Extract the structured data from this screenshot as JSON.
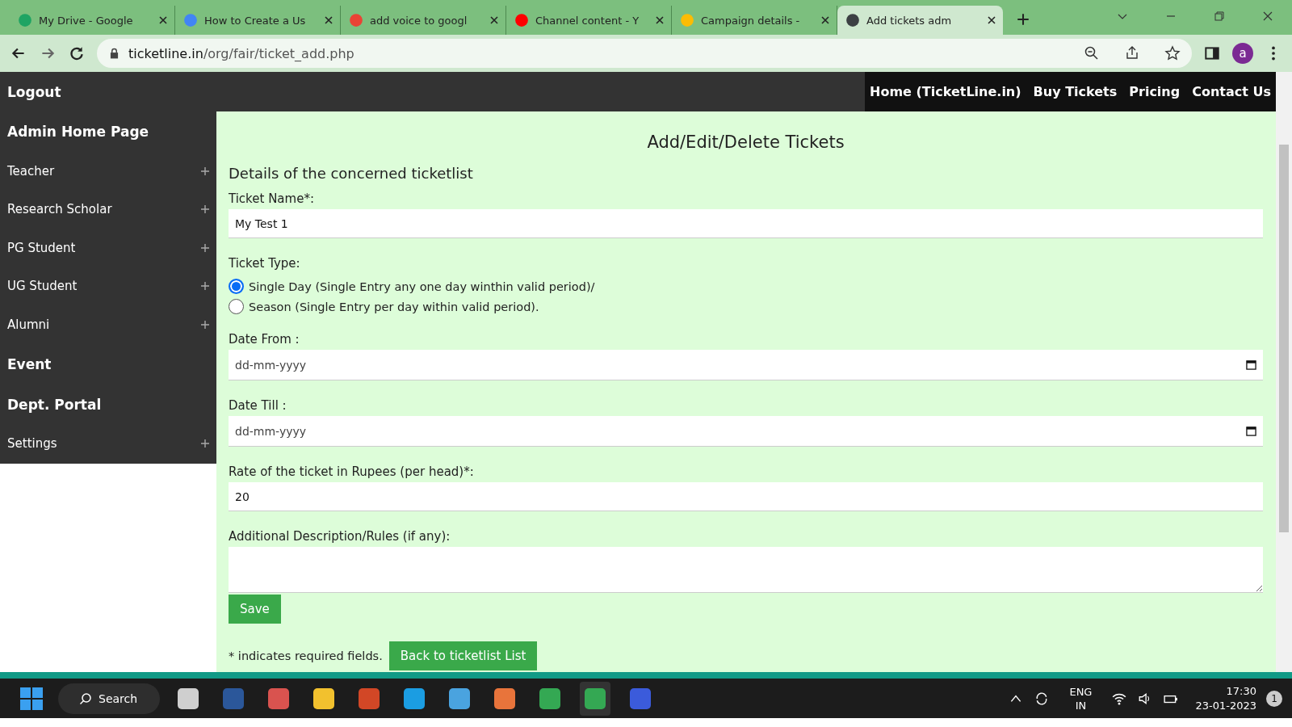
{
  "browser": {
    "tabs": [
      {
        "title": "My Drive - Google",
        "selected": false
      },
      {
        "title": "How to Create a Us",
        "selected": false
      },
      {
        "title": "add voice to googl",
        "selected": false
      },
      {
        "title": "Channel content - Y",
        "selected": false
      },
      {
        "title": "Campaign details -",
        "selected": false
      },
      {
        "title": "Add tickets adm",
        "selected": true
      }
    ],
    "url_host": "ticketline.in",
    "url_path": "/org/fair/ticket_add.php",
    "profile": "a"
  },
  "header": {
    "logout": "Logout",
    "nav": [
      "Home (TicketLine.in)",
      "Buy Tickets",
      "Pricing",
      "Contact Us"
    ]
  },
  "sidebar": {
    "items": [
      {
        "label": "Admin Home Page",
        "expandable": false
      },
      {
        "label": "Teacher",
        "expandable": true
      },
      {
        "label": "Research Scholar",
        "expandable": true
      },
      {
        "label": "PG Student",
        "expandable": true
      },
      {
        "label": "UG Student",
        "expandable": true
      },
      {
        "label": "Alumni",
        "expandable": true
      },
      {
        "label": "Event",
        "expandable": false
      },
      {
        "label": "Dept. Portal",
        "expandable": false
      },
      {
        "label": "Settings",
        "expandable": true
      }
    ]
  },
  "form": {
    "title": "Add/Edit/Delete Tickets",
    "subtitle": "Details of the concerned ticketlist",
    "ticket_name": {
      "label": "Ticket Name*:",
      "value": "My Test 1"
    },
    "ticket_type": {
      "label": "Ticket Type:",
      "options": [
        {
          "label": "Single Day (Single Entry any one day winthin valid period)/",
          "selected": true
        },
        {
          "label": "Season (Single Entry per day within valid period).",
          "selected": false
        }
      ]
    },
    "date_from": {
      "label": "Date From :",
      "placeholder": "dd-mm-yyyy"
    },
    "date_till": {
      "label": "Date Till :",
      "placeholder": "dd-mm-yyyy"
    },
    "rate": {
      "label": "Rate of the ticket in Rupees (per head)*:",
      "value": "20"
    },
    "description": {
      "label": "Additional Description/Rules (if any):"
    },
    "save": "Save",
    "note": "* indicates required fields.",
    "back": "Back to ticketlist List"
  },
  "taskbar": {
    "search": "Search",
    "lang": "ENG",
    "region": "IN",
    "time": "17:30",
    "date": "23-01-2023",
    "notifications": "1"
  }
}
